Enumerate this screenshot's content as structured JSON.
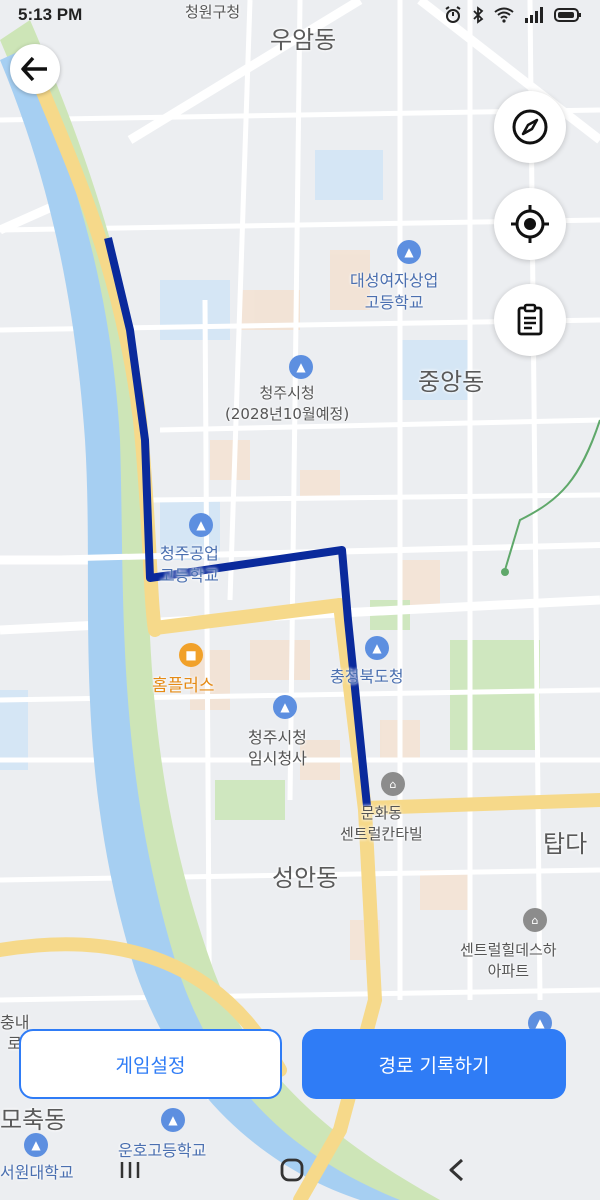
{
  "status_bar": {
    "time": "5:13 PM",
    "alarm_icon": "alarm-icon",
    "bluetooth_icon": "bluetooth-icon",
    "wifi_icon": "wifi-icon",
    "signal_icon": "signal-icon",
    "battery_icon": "battery-icon"
  },
  "map": {
    "labels": {
      "cheongwon_gu": "청원구청",
      "uam_dong": "우암동",
      "daeseong_school": "대성여자상업\n고등학교",
      "jungang_dong": "중앙동",
      "city_hall": "청주시청\n(2028년10월예정)",
      "cheongju_tech": "청주공업\n고등학교",
      "homeplus": "홈플러스",
      "chungbuk_office": "충청북도청",
      "temp_city_hall": "청주시청\n임시청사",
      "munhwa_dong": "문화동\n센트럴칸타빌",
      "tapdong": "탑다",
      "seongan_dong": "성안동",
      "central_hills": "센트럴힐데스하\n아파트",
      "mochung_dong": "모축동",
      "unho_school": "운호고등학교",
      "seowon_univ": "서원대학교",
      "left_cut": "충내\n로"
    }
  },
  "controls": {
    "back_icon": "arrow-left-icon",
    "compass_icon": "compass-icon",
    "locate_icon": "locate-icon",
    "clipboard_icon": "clipboard-icon"
  },
  "buttons": {
    "game_settings": "게임설정",
    "record_route": "경로 기록하기"
  },
  "nav": {
    "recents_icon": "recents-icon",
    "home_icon": "home-icon",
    "back_icon": "back-triangle-icon"
  },
  "colors": {
    "primary": "#2f7cf6",
    "route": "#0a2a9c",
    "major_road": "#f6d98a",
    "river": "#9bc7ef",
    "park": "#c8e3b4"
  }
}
